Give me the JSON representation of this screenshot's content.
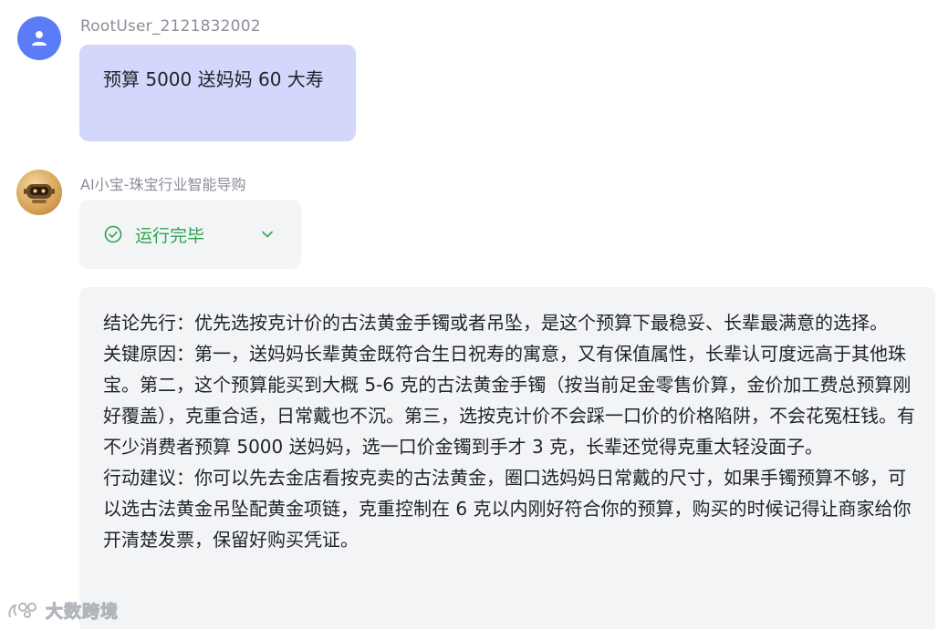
{
  "user_message": {
    "username": "RootUser_2121832002",
    "text": "预算 5000 送妈妈 60 大寿",
    "avatar_icon": "user-icon",
    "avatar_color": "#5b7cf6",
    "bubble_color": "#d2d7fb"
  },
  "ai_message": {
    "name": "AI小宝-珠宝行业智能导购",
    "avatar_icon": "robot-icon",
    "avatar_color": "#d9a65a",
    "status": {
      "label": "运行完毕",
      "icon": "check-circle-icon",
      "toggle_icon": "chevron-down-icon",
      "color": "#2da44e"
    },
    "paragraphs": [
      "结论先行：优先选按克计价的古法黄金手镯或者吊坠，是这个预算下最稳妥、长辈最满意的选择。",
      "关键原因：第一，送妈妈长辈黄金既符合生日祝寿的寓意，又有保值属性，长辈认可度远高于其他珠宝。第二，这个预算能买到大概 5-6 克的古法黄金手镯（按当前足金零售价算，金价加工费总预算刚好覆盖），克重合适，日常戴也不沉。第三，选按克计价不会踩一口价的价格陷阱，不会花冤枉钱。有不少消费者预算 5000 送妈妈，选一口价金镯到手才 3 克，长辈还觉得克重太轻没面子。",
      "行动建议：你可以先去金店看按克卖的古法黄金，圈口选妈妈日常戴的尺寸，如果手镯预算不够，可以选古法黄金吊坠配黄金项链，克重控制在 6 克以内刚好符合你的预算，购买的时候记得让商家给你开清楚发票，保留好购买凭证。"
    ]
  },
  "watermark": {
    "text": "大数跨境",
    "icon": "brand-logo-icon"
  }
}
